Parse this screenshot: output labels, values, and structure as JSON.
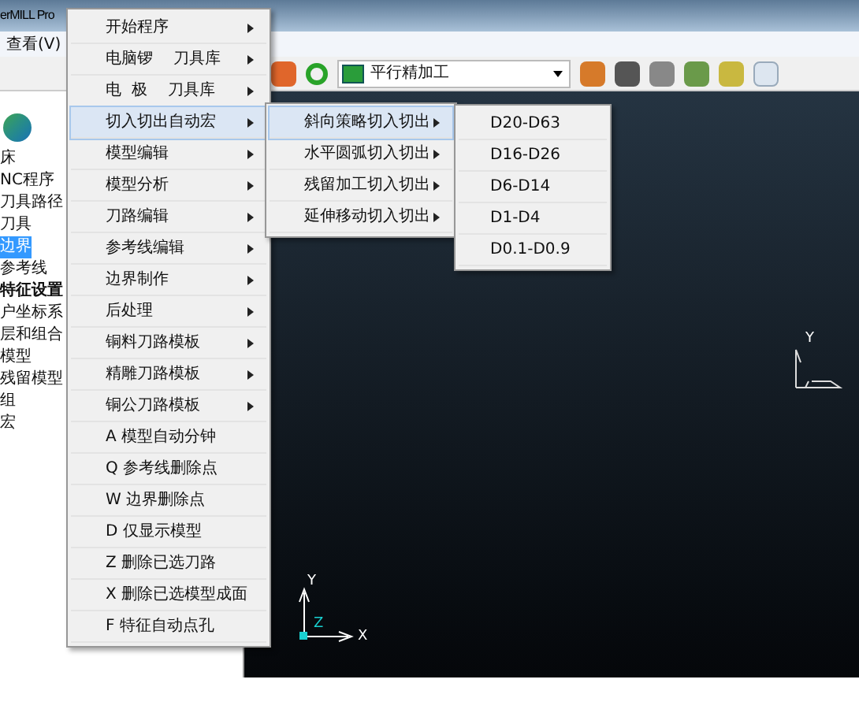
{
  "window": {
    "title": "erMILL Pro"
  },
  "menubar": [
    "查看(V)"
  ],
  "toolbar": {
    "strategy_field": {
      "value": "平行精加工"
    }
  },
  "explorer": {
    "items": [
      {
        "label": "床",
        "selected": false
      },
      {
        "label": "NC程序",
        "selected": false
      },
      {
        "label": "刀具路径",
        "selected": false
      },
      {
        "label": "刀具",
        "selected": false
      },
      {
        "label": "边界",
        "selected": true
      },
      {
        "label": "参考线",
        "selected": false
      },
      {
        "label": "特征设置",
        "selected": false
      },
      {
        "label": "户坐标系",
        "selected": false
      },
      {
        "label": "层和组合",
        "selected": false
      },
      {
        "label": "模型",
        "selected": false
      },
      {
        "label": "残留模型",
        "selected": false
      },
      {
        "label": "组",
        "selected": false
      },
      {
        "label": "宏",
        "selected": false
      }
    ]
  },
  "context_menu": {
    "items": [
      {
        "label": "开始程序",
        "submenu": true,
        "selected": false
      },
      {
        "label": "电脑锣　 刀具库",
        "submenu": true,
        "selected": false
      },
      {
        "label": "电  极　 刀具库",
        "submenu": true,
        "selected": false
      },
      {
        "label": "切入切出自动宏",
        "submenu": true,
        "selected": true
      },
      {
        "label": "模型编辑",
        "submenu": true,
        "selected": false
      },
      {
        "label": "模型分析",
        "submenu": true,
        "selected": false
      },
      {
        "label": "刀路编辑",
        "submenu": true,
        "selected": false
      },
      {
        "label": "参考线编辑",
        "submenu": true,
        "selected": false
      },
      {
        "label": "边界制作",
        "submenu": true,
        "selected": false
      },
      {
        "label": "后处理",
        "submenu": true,
        "selected": false
      },
      {
        "label": "铜料刀路模板",
        "submenu": true,
        "selected": false
      },
      {
        "label": "精雕刀路模板",
        "submenu": true,
        "selected": false
      },
      {
        "label": "铜公刀路模板",
        "submenu": true,
        "selected": false
      },
      {
        "label": "A 模型自动分钟",
        "submenu": false,
        "selected": false
      },
      {
        "label": "Q 参考线删除点",
        "submenu": false,
        "selected": false
      },
      {
        "label": "W 边界删除点",
        "submenu": false,
        "selected": false
      },
      {
        "label": "D 仅显示模型",
        "submenu": false,
        "selected": false
      },
      {
        "label": "Z 删除已选刀路",
        "submenu": false,
        "selected": false
      },
      {
        "label": "X 删除已选模型成面",
        "submenu": false,
        "selected": false
      },
      {
        "label": "F 特征自动点孔",
        "submenu": false,
        "selected": false
      }
    ]
  },
  "submenu": {
    "items": [
      {
        "label": "斜向策略切入切出",
        "submenu": true,
        "selected": true
      },
      {
        "label": "水平圆弧切入切出",
        "submenu": true,
        "selected": false
      },
      {
        "label": "残留加工切入切出",
        "submenu": true,
        "selected": false
      },
      {
        "label": "延伸移动切入切出",
        "submenu": true,
        "selected": false
      }
    ]
  },
  "submenu_2": {
    "items": [
      {
        "label": "D20-D63",
        "selected": false
      },
      {
        "label": "D16-D26",
        "selected": false
      },
      {
        "label": "D6-D14",
        "selected": false
      },
      {
        "label": "D1-D4",
        "selected": false
      },
      {
        "label": "D0.1-D0.9",
        "selected": false
      }
    ]
  },
  "viewport": {
    "triad": {
      "x": "X",
      "y": "Y",
      "z": "Z"
    },
    "view_cube": {
      "y": "Y"
    }
  }
}
